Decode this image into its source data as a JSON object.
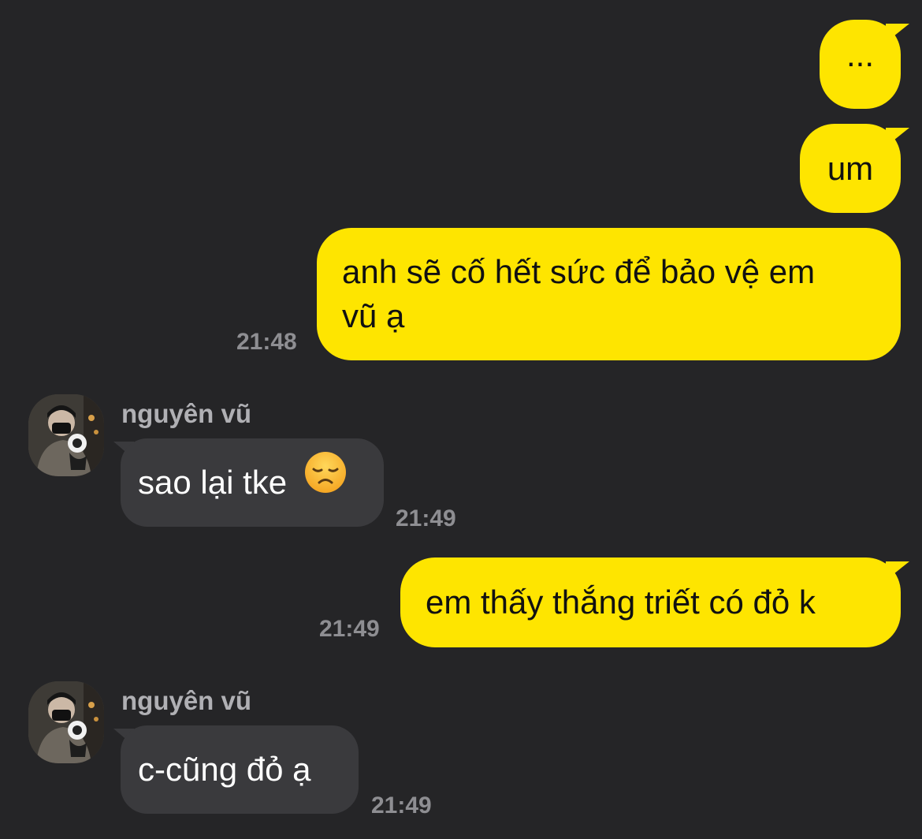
{
  "messages": [
    {
      "type": "outgoing",
      "text": "..."
    },
    {
      "type": "outgoing",
      "text": "um"
    },
    {
      "type": "outgoing",
      "line1": "anh sẽ cố hết sức để bảo vệ em",
      "line2": "vũ ạ",
      "time": "21:48"
    },
    {
      "type": "incoming",
      "sender": "nguyên vũ",
      "text": "sao lại tke",
      "emoji": "disappointed-face-icon",
      "time": "21:49"
    },
    {
      "type": "outgoing",
      "text": "em thấy thắng triết có đỏ k",
      "time": "21:49"
    },
    {
      "type": "incoming",
      "sender": "nguyên vũ",
      "text": "c-cũng đỏ ạ",
      "time": "21:49"
    }
  ],
  "colors": {
    "background": "#252527",
    "outgoing_bubble": "#fee500",
    "incoming_bubble": "#3a3a3d",
    "timestamp": "#8e8e92"
  }
}
